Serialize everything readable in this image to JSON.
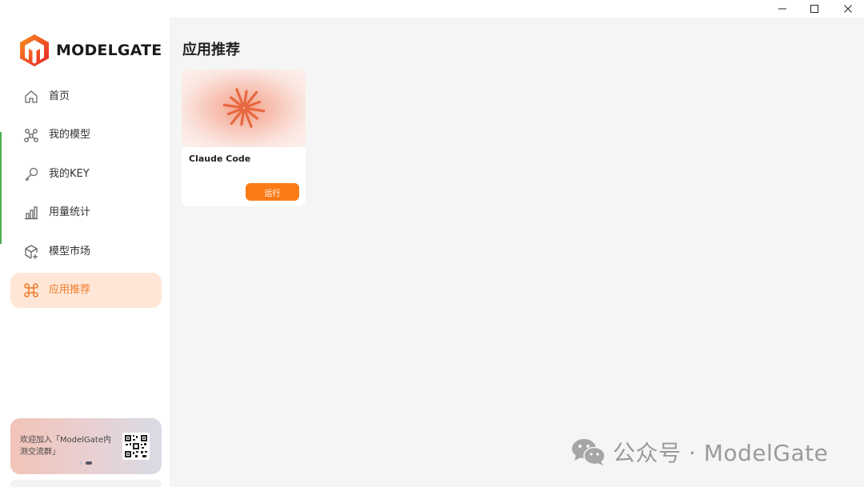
{
  "window": {
    "minimize_icon": "minimize-icon",
    "maximize_icon": "maximize-icon",
    "close_icon": "close-icon"
  },
  "brand": {
    "name": "MODELGATE",
    "logo_colors": [
      "#f04e23",
      "#f7931e"
    ]
  },
  "sidebar": {
    "items": [
      {
        "label": "首页",
        "icon": "home-icon",
        "active": false
      },
      {
        "label": "我的模型",
        "icon": "model-graph-icon",
        "active": false
      },
      {
        "label": "我的KEY",
        "icon": "key-icon",
        "active": false
      },
      {
        "label": "用量统计",
        "icon": "bar-chart-icon",
        "active": false
      },
      {
        "label": "模型市场",
        "icon": "cube-plus-icon",
        "active": false
      },
      {
        "label": "应用推荐",
        "icon": "command-icon",
        "active": true
      }
    ],
    "promo": {
      "text": "欢迎加入「ModelGate内测交流群」",
      "qr_icon": "qr-code-icon"
    }
  },
  "main": {
    "title": "应用推荐",
    "apps": [
      {
        "name": "Claude Code",
        "run_label": "运行",
        "icon": "claude-sunburst-icon"
      }
    ]
  },
  "watermark": {
    "text": "公众号 · ModelGate",
    "icon": "wechat-icon"
  },
  "colors": {
    "accent": "#fc7b16",
    "active_bg": "#ffe6d6",
    "active_text": "#f07c2a",
    "sidebar_edge": "#4caf50"
  }
}
